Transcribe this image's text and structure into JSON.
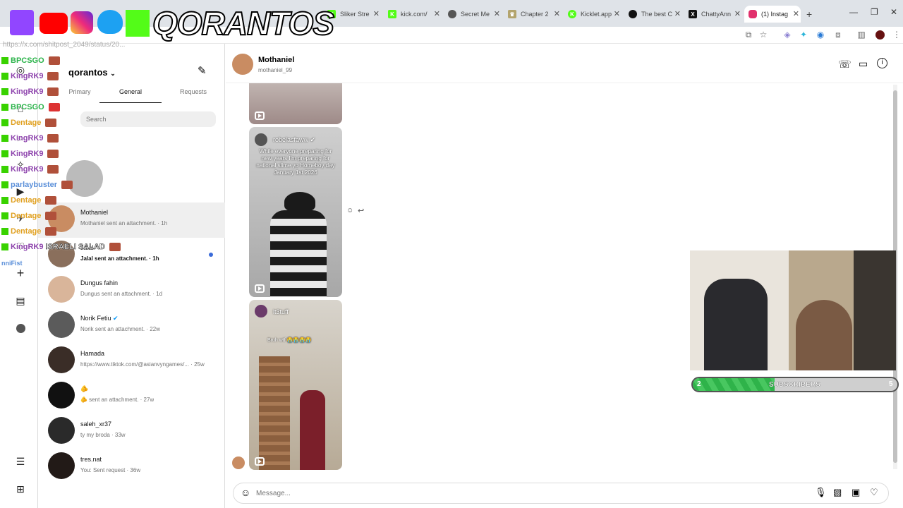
{
  "overlay": {
    "logo_text": "QORANTOS",
    "url_text": "https://x.com/shitpost_2049/status/20...",
    "chat_lines": [
      "BPCSGO",
      "KingRK9",
      "KingRK9",
      "BPCSGO",
      "Dentage",
      "KingRK9",
      "KingRK9",
      "KingRK9",
      "parlaybuster",
      "Dentage",
      "Dentage",
      "Dentage",
      "KingRK9"
    ],
    "israeli_salad": "ISRAELI SALAD",
    "fist_text": "nniFist",
    "sub_count": "2",
    "sub_label": "SUBSCRIBERS",
    "sub_goal": "5"
  },
  "browser": {
    "tabs": [
      {
        "label": "Sliker Stre",
        "color": "#53fc18"
      },
      {
        "label": "kick.com/",
        "color": "#53fc18"
      },
      {
        "label": "Secret Me",
        "color": "#555555"
      },
      {
        "label": "Chapter 2",
        "color": "#b3a46d"
      },
      {
        "label": "Kicklet.app",
        "color": "#53fc18"
      },
      {
        "label": "The best C",
        "color": "#111111"
      },
      {
        "label": "ChattyAnn",
        "color": "#111111"
      },
      {
        "label": "(1) Instag",
        "color": "#e1306c"
      }
    ]
  },
  "sidebar": {
    "account_name": "qorantos",
    "tabs": [
      "Primary",
      "General",
      "Requests"
    ],
    "search_placeholder": "Search",
    "conversations": [
      {
        "name": "Mothaniel",
        "sub": "Mothaniel sent an attachment. · 1h"
      },
      {
        "name": "Jalal",
        "sub": "Jalal sent an attachment. · 1h"
      },
      {
        "name": "Dungus fahin",
        "sub": "Dungus sent an attachment. · 1d"
      },
      {
        "name": "Norik Fetiu",
        "sub": "Norik sent an attachment. · 22w"
      },
      {
        "name": "Hamada",
        "sub": "https://www.tiktok.com/@asianvyngames/... · 25w"
      },
      {
        "name": "🫵",
        "sub": "🫵 sent an attachment. · 27w"
      },
      {
        "name": "saleh_xr37",
        "sub": "ty my broda · 33w"
      },
      {
        "name": "tres.nat",
        "sub": "You: Sent request · 36w"
      }
    ]
  },
  "chat": {
    "name": "Mothaniel",
    "handle": "mothaniel_99",
    "reel1_user": "robelasfaww",
    "reel1_caption": "While everyone preparing for new years I'm preparing for national slime yo Homeboy day January 1st 2026",
    "reel2_user": "lt3tuff",
    "reel2_caption": "Bruh wtf 😭😭😭😭",
    "composer_placeholder": "Message..."
  },
  "colors": {
    "unread_dot": "#3a6bd9",
    "verified": "#0095f6",
    "kick_green": "#53fc18",
    "sub_fill": "#2fb34a"
  },
  "progress": {
    "subscribers_fraction": 0.4
  }
}
